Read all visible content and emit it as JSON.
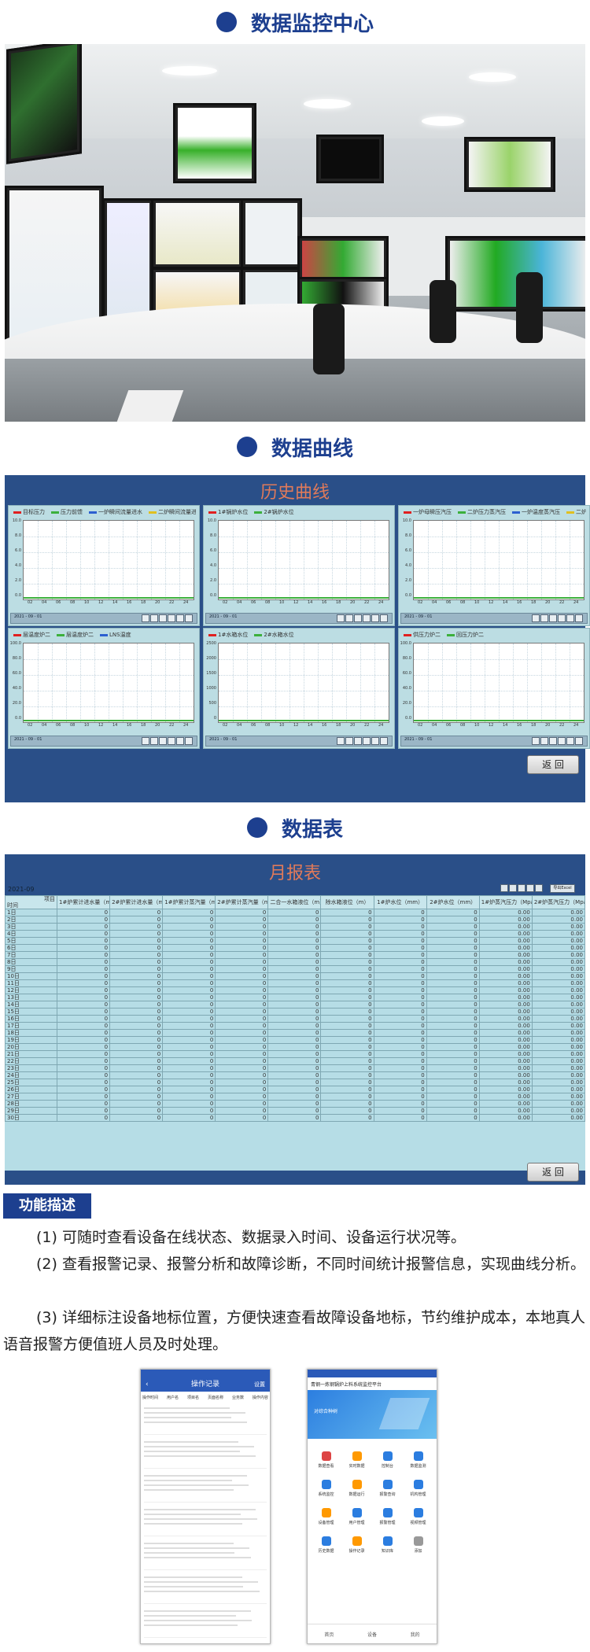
{
  "sections": {
    "monitor_title": "数据监控中心",
    "curve_title": "数据曲线",
    "table_title": "数据表"
  },
  "history": {
    "title": "历史曲线",
    "return_label": "返  回",
    "charts": [
      {
        "legend": [
          "目标压力",
          "压力前馈",
          "一炉瞬间流量进水",
          "二炉瞬间流量进水"
        ],
        "colors": [
          "#e02020",
          "#3cb03c",
          "#2c5fd0",
          "#e0c020"
        ],
        "yticks": [
          "10.0",
          "8.0",
          "6.0",
          "4.0",
          "2.0",
          "0.0"
        ]
      },
      {
        "legend": [
          "1#锅炉水位",
          "2#锅炉水位"
        ],
        "colors": [
          "#e02020",
          "#3cb03c"
        ],
        "yticks": [
          "10.0",
          "8.0",
          "6.0",
          "4.0",
          "2.0",
          "0.0"
        ]
      },
      {
        "legend": [
          "一炉母瞬压汽压",
          "二炉压力蒸汽压",
          "一炉温度蒸汽压",
          "二炉温度蒸汽压"
        ],
        "colors": [
          "#e02020",
          "#3cb03c",
          "#2c5fd0",
          "#e0c020"
        ],
        "yticks": [
          "10.0",
          "8.0",
          "6.0",
          "4.0",
          "2.0",
          "0.0"
        ]
      },
      {
        "legend": [
          "层温度炉二",
          "层温度炉二",
          "LNS温度"
        ],
        "colors": [
          "#e02020",
          "#3cb03c",
          "#2c5fd0"
        ],
        "yticks": [
          "100.0",
          "80.0",
          "60.0",
          "40.0",
          "20.0",
          "0.0"
        ]
      },
      {
        "legend": [
          "1#水箱水位",
          "2#水箱水位"
        ],
        "colors": [
          "#e02020",
          "#3cb03c"
        ],
        "yticks": [
          "2500",
          "2000",
          "1500",
          "1000",
          "500",
          "0"
        ]
      },
      {
        "legend": [
          "供压力炉二",
          "回压力炉二"
        ],
        "colors": [
          "#e02020",
          "#3cb03c"
        ],
        "yticks": [
          "100.0",
          "80.0",
          "60.0",
          "40.0",
          "20.0",
          "0.0"
        ]
      }
    ],
    "xticks": [
      "02",
      "04",
      "06",
      "08",
      "10",
      "12",
      "14",
      "16",
      "18",
      "20",
      "22",
      "24"
    ],
    "date_label": "2021 - 09 - 01"
  },
  "month": {
    "title": "月报表",
    "period": "2021-09",
    "corner_top": "项目",
    "corner_bottom": "时间",
    "export_label": "导出Excel",
    "columns": [
      "1#炉累计进水量（m3）",
      "2#炉累计进水量（m3）",
      "1#炉累计蒸汽量（m3）",
      "2#炉累计蒸汽量（m3）",
      "二合一水箱液位（m）",
      "除水箱液位（m）",
      "1#炉水位（mm）",
      "2#炉水位（mm）",
      "1#炉蒸汽压力（Mpa）",
      "2#炉蒸汽压力（Mpa）"
    ],
    "rows": [
      "1日",
      "2日",
      "3日",
      "4日",
      "5日",
      "6日",
      "7日",
      "8日",
      "9日",
      "10日",
      "11日",
      "12日",
      "13日",
      "14日",
      "15日",
      "16日",
      "17日",
      "18日",
      "19日",
      "20日",
      "21日",
      "22日",
      "23日",
      "24日",
      "25日",
      "26日",
      "27日",
      "28日",
      "29日",
      "30日"
    ],
    "zero": "0",
    "zero_dec": "0.00",
    "return_label": "返  回"
  },
  "desc": {
    "badge": "功能描述",
    "p1": "(1) 可随时查看设备在线状态、数据录入时间、设备运行状况等。",
    "p2": "(2) 查看报警记录、报警分析和故障诊断，不同时间统计报警信息，实现曲线分析。",
    "p3": "(3) 详细标注设备地标位置，方便快速查看故障设备地标，节约维护成本，本地真人语音报警方便值班人员及时处理。"
  },
  "phone_left": {
    "title": "操作记录",
    "action": "设置",
    "headers": [
      "操作时间",
      "用户名",
      "项目名",
      "页面名称",
      "业务数",
      "操作内容"
    ]
  },
  "phone_right": {
    "title": "青钢一炼钢锅炉上料系统监控平台",
    "banner": "对综合种树",
    "icons": [
      "数据查看",
      "实时数据",
      "控制台",
      "数据监测",
      "系统监控",
      "数据运行",
      "报警查询",
      "机构管理",
      "设备管理",
      "用户管理",
      "报警管理",
      "视频管理",
      "历史数据",
      "操作记录",
      "知识库",
      "添加"
    ],
    "tabs": [
      "首页",
      "设备",
      "我的"
    ]
  }
}
